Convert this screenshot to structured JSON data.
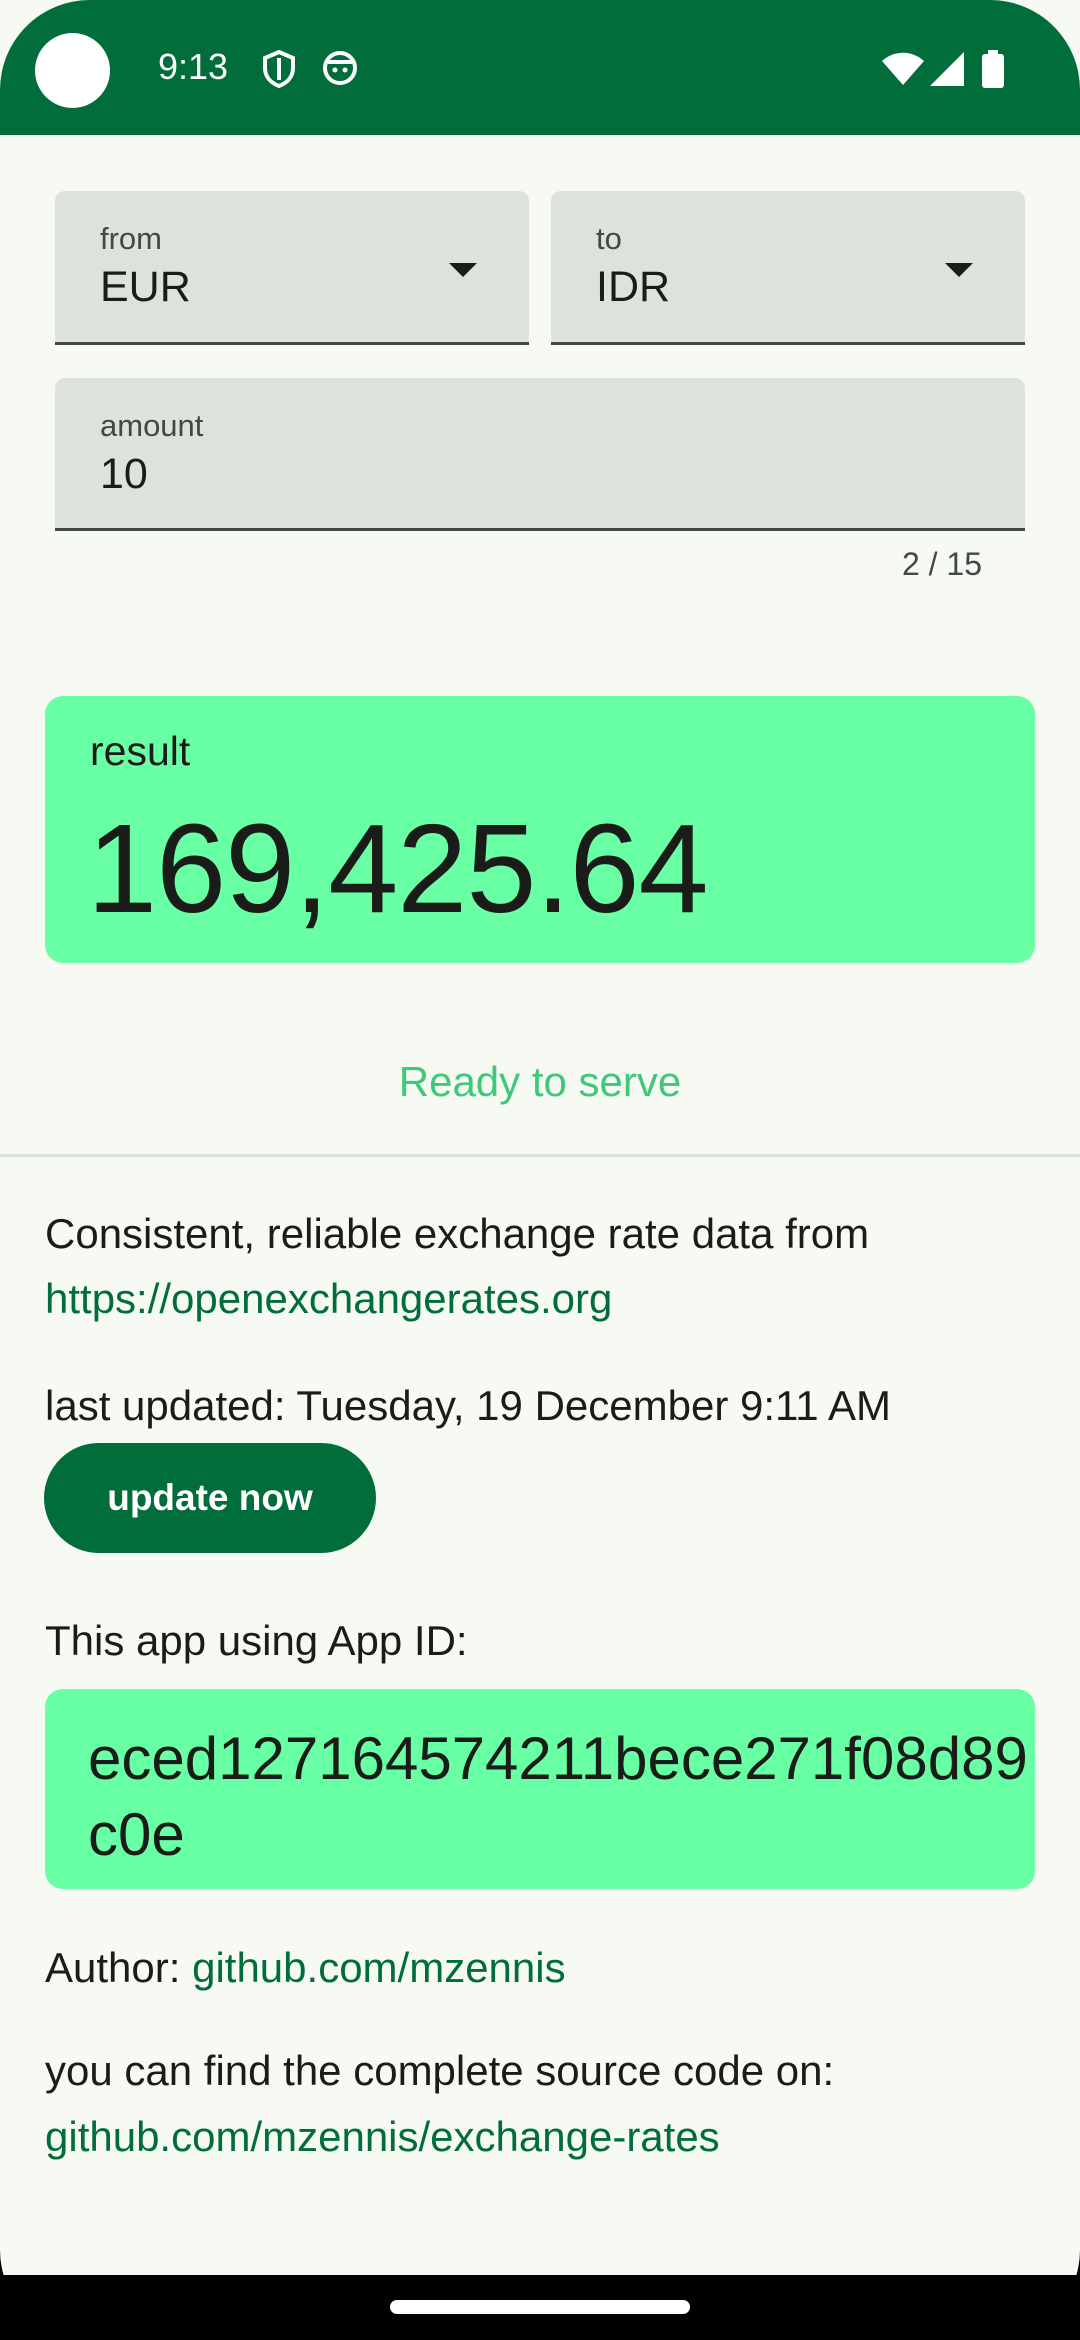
{
  "status_bar": {
    "time": "9:13",
    "icons": [
      "shield-icon",
      "android-face-icon",
      "wifi-icon",
      "signal-icon",
      "battery-icon"
    ]
  },
  "form": {
    "from_label": "from",
    "from_value": "EUR",
    "to_label": "to",
    "to_value": "IDR",
    "amount_label": "amount",
    "amount_value": "10",
    "amount_counter": "2 / 15"
  },
  "result": {
    "label": "result",
    "value": "169,425.64"
  },
  "status_text": "Ready to serve",
  "info": {
    "source_text": "Consistent, reliable exchange rate data from",
    "source_link": "https://openexchangerates.org",
    "last_updated": "last updated: Tuesday, 19 December 9:11 AM",
    "update_button": "update now",
    "app_id_label": "This app using App ID:",
    "app_id": "eced127164574211bece271f08d89c0e",
    "author_label": "Author: ",
    "author_link": "github.com/mzennis",
    "source_code_text": "you can find the complete source code on:",
    "source_code_link": "github.com/mzennis/exchange-rates"
  },
  "colors": {
    "primary": "#006d3b",
    "accent_card": "#69ffa4",
    "status_text": "#3ec878",
    "field_bg": "#dde3da",
    "background": "#f7f9f3"
  }
}
